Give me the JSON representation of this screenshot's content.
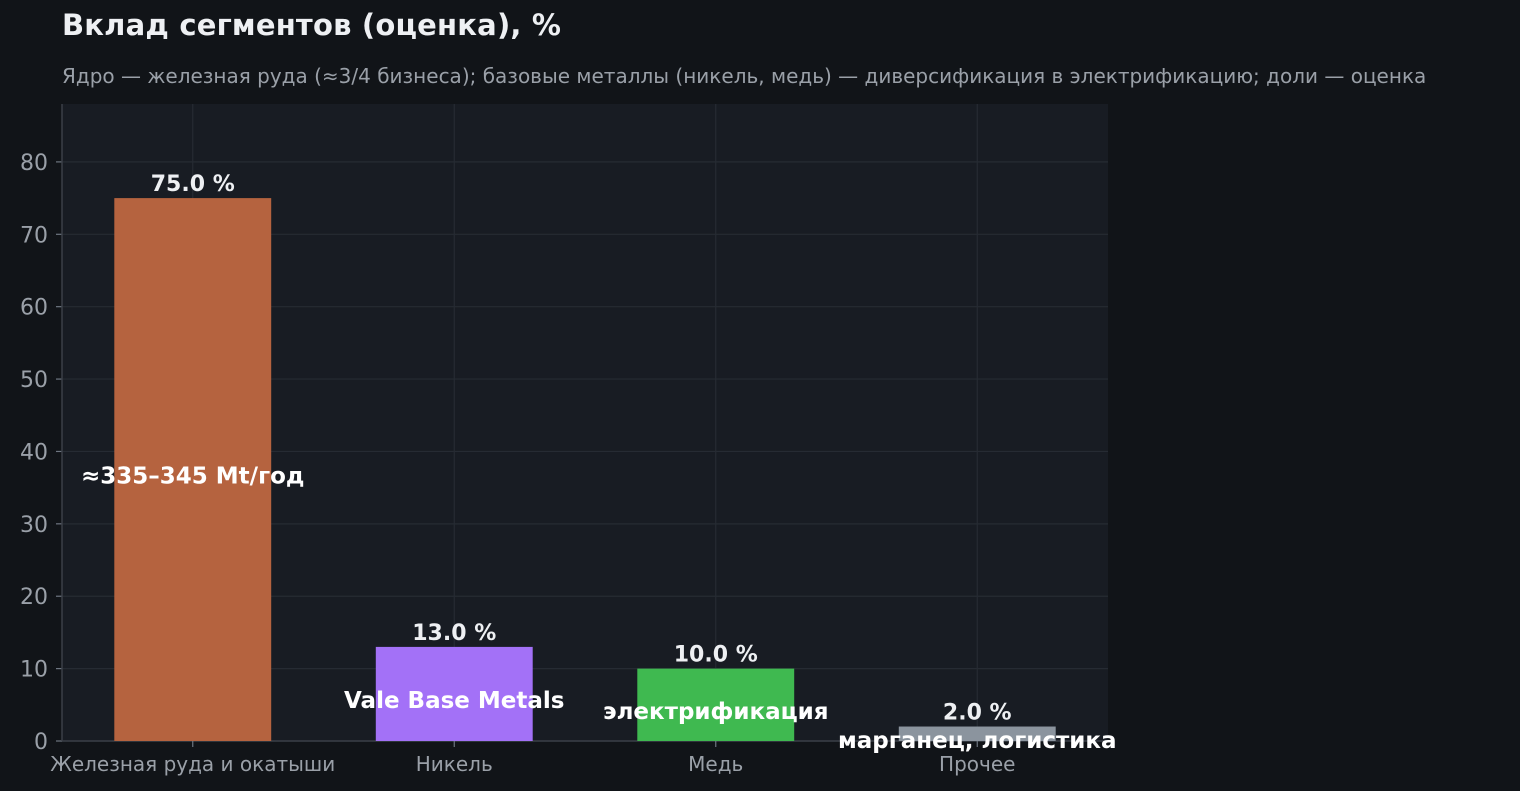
{
  "chart_data": {
    "type": "bar",
    "title": "Вклад сегментов (оценка), %",
    "subtitle": "Ядро — железная руда (≈3/4 бизнеса); базовые металлы (никель, медь) — диверсификация в электрификацию; доли — оценка",
    "xlabel": "",
    "ylabel": "",
    "categories": [
      "Железная руда и окатыши",
      "Никель",
      "Медь",
      "Прочее"
    ],
    "values": [
      75.0,
      13.0,
      10.0,
      2.0
    ],
    "value_labels": [
      "75.0 %",
      "13.0 %",
      "10.0 %",
      "2.0 %"
    ],
    "bar_annotations": [
      "≈335–345 Mt/год",
      "Vale Base Metals",
      "электрификация",
      "марганец, логистика"
    ],
    "colors": [
      "#b5633f",
      "#a371f7",
      "#3fb950",
      "#8b949e"
    ],
    "ylim": [
      0,
      88
    ],
    "yticks": [
      0,
      10,
      20,
      30,
      40,
      50,
      60,
      70,
      80
    ],
    "grid": true,
    "legend": "none"
  }
}
